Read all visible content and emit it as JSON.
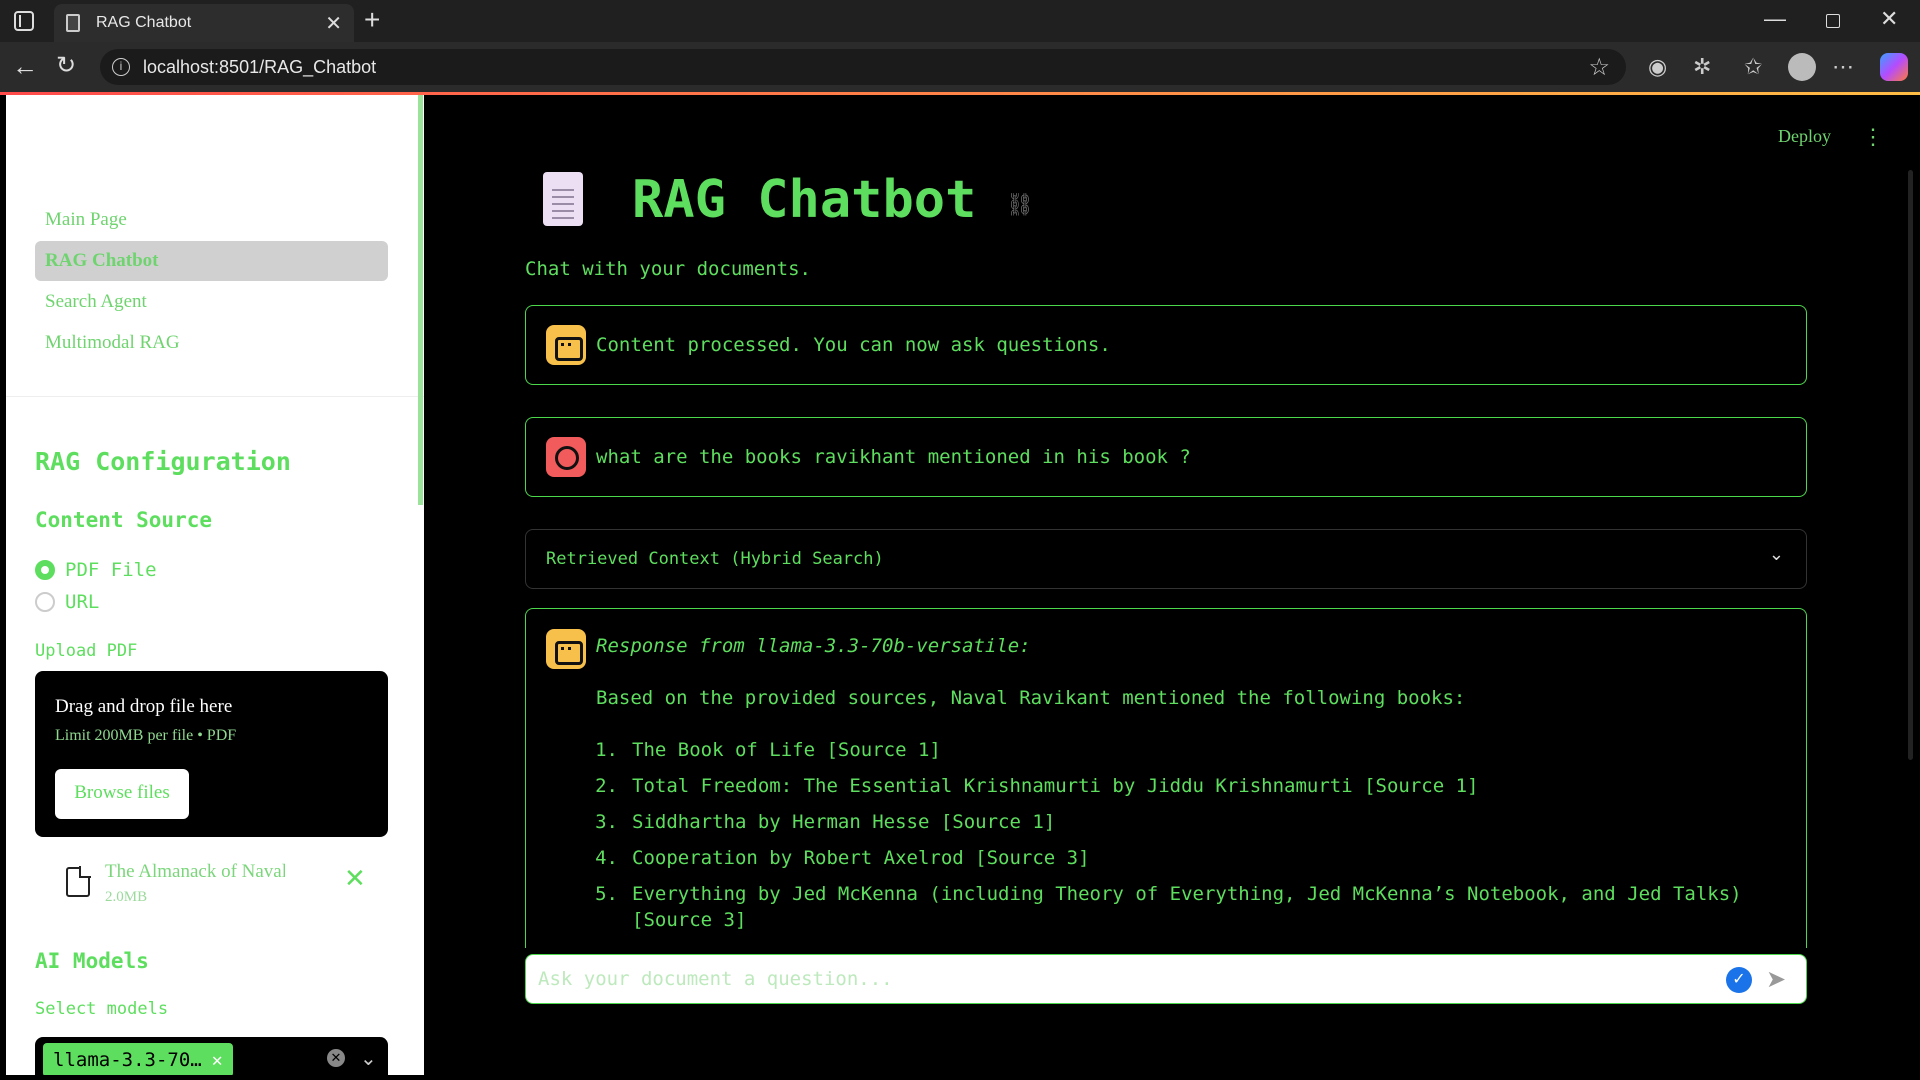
{
  "browser": {
    "tab_title": "RAG Chatbot",
    "url": "localhost:8501/RAG_Chatbot"
  },
  "sidebar": {
    "nav": [
      {
        "label": "Main Page"
      },
      {
        "label": "RAG Chatbot",
        "active": true
      },
      {
        "label": "Search Agent"
      },
      {
        "label": "Multimodal RAG"
      }
    ],
    "config_title": "RAG Configuration",
    "content_source_title": "Content Source",
    "source_options": [
      {
        "label": "PDF File",
        "selected": true
      },
      {
        "label": "URL",
        "selected": false
      }
    ],
    "upload_label": "Upload PDF",
    "dropzone": {
      "title": "Drag and drop file here",
      "subtitle": "Limit 200MB per file • PDF",
      "button": "Browse files"
    },
    "uploaded_file": {
      "name": "The Almanack of Naval ...",
      "size": "2.0MB"
    },
    "ai_models_title": "AI Models",
    "select_models_label": "Select models",
    "selected_model": "llama-3.3-70…"
  },
  "header": {
    "deploy_label": "Deploy",
    "more_icon": "⋮"
  },
  "main": {
    "title": "RAG Chatbot",
    "subtitle": "Chat with your documents.",
    "messages": [
      {
        "role": "assistant",
        "text": "Content processed. You can now ask questions."
      },
      {
        "role": "user",
        "text": "what are the books ravikhant mentioned in his book ?"
      }
    ],
    "expander_label": "Retrieved Context (Hybrid Search)",
    "response": {
      "header": "Response from llama-3.3-70b-versatile:",
      "intro": "Based on the provided sources, Naval Ravikant mentioned the following books:",
      "items": [
        {
          "num": "1.",
          "text": "The Book of Life [Source 1]"
        },
        {
          "num": "2.",
          "text": "Total Freedom: The Essential Krishnamurti by Jiddu Krishnamurti [Source 1]"
        },
        {
          "num": "3.",
          "text": "Siddhartha by Herman Hesse [Source 1]"
        },
        {
          "num": "4.",
          "text": "Cooperation by Robert Axelrod [Source 3]"
        },
        {
          "num": "5.",
          "text": "Everything by Jed McKenna (including Theory of Everything, Jed McKenna’s Notebook, and Jed Talks) [Source 3]"
        }
      ]
    },
    "chat_input_placeholder": "Ask your document a question..."
  },
  "colors": {
    "accent": "#5ede5e",
    "background": "#000000",
    "sidebar_bg": "#ffffff",
    "bot_avatar": "#f7c04a",
    "user_avatar": "#f25b5b"
  },
  "icons": {
    "tab": "document-icon",
    "title": "page-facing-up-icon",
    "link": "link-icon",
    "send": "send-icon"
  }
}
